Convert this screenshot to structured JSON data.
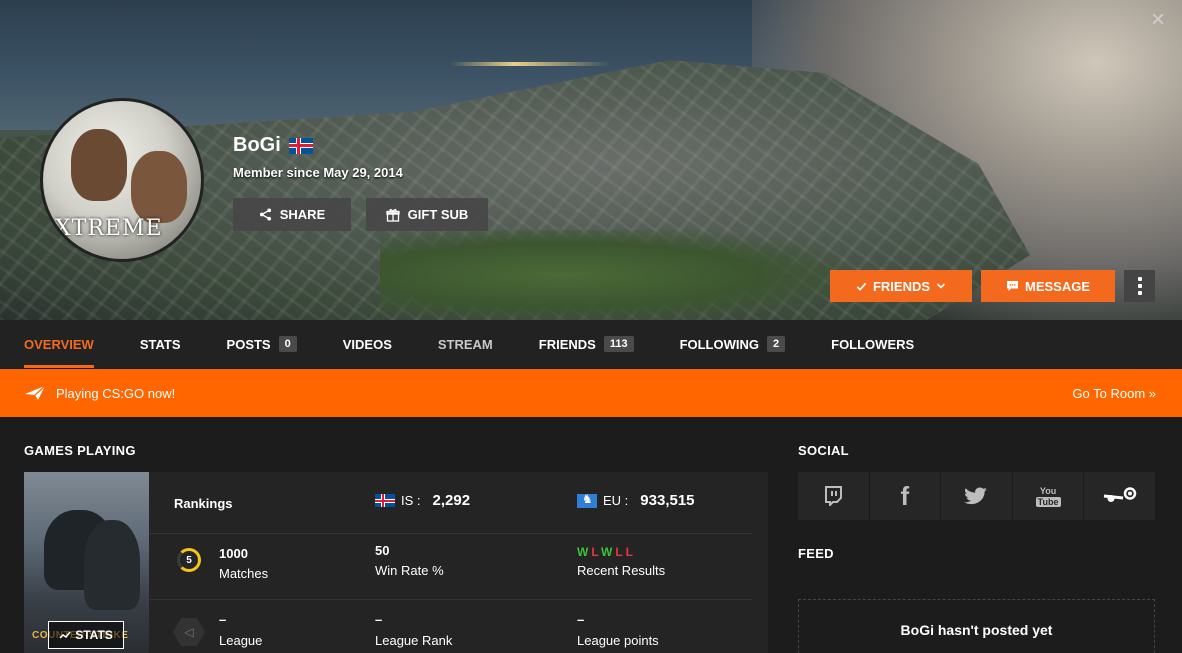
{
  "profile": {
    "username": "BoGi",
    "member_since": "Member since May 29, 2014",
    "avatar_text": "XTREME",
    "share_label": "SHARE",
    "gift_label": "GIFT SUB",
    "friends_label": "FRIENDS",
    "message_label": "MESSAGE",
    "close_glyph": "×"
  },
  "nav": {
    "tabs": [
      {
        "label": "OVERVIEW",
        "count": null,
        "active": true
      },
      {
        "label": "STATS",
        "count": null
      },
      {
        "label": "POSTS",
        "count": "0"
      },
      {
        "label": "VIDEOS",
        "count": null
      },
      {
        "label": "STREAM",
        "count": null
      },
      {
        "label": "FRIENDS",
        "count": "113"
      },
      {
        "label": "FOLLOWING",
        "count": "2"
      },
      {
        "label": "FOLLOWERS",
        "count": null
      }
    ]
  },
  "playing": {
    "status": "Playing CS:GO now!",
    "action": "Go To Room »"
  },
  "games": {
    "title": "GAMES PLAYING",
    "cover_text": "COUNTER-STRIKE",
    "stats_button": "STATS",
    "rankings_label": "Rankings",
    "is_region": "IS :",
    "is_value": "2,292",
    "eu_region": "EU :",
    "eu_value": "933,515",
    "matches_ring": "5",
    "matches_value": "1000",
    "matches_label": "Matches",
    "winrate_value": "50",
    "winrate_label": "Win Rate %",
    "recent_results": [
      "W",
      "L",
      "W",
      "L",
      "L"
    ],
    "recent_label": "Recent Results",
    "league_value": "–",
    "league_label": "League",
    "league_rank_value": "–",
    "league_rank_label": "League Rank",
    "league_points_value": "–",
    "league_points_label": "League points"
  },
  "social": {
    "title": "SOCIAL",
    "items": [
      {
        "name": "twitch",
        "glyph": "⌨"
      },
      {
        "name": "facebook",
        "glyph": "f"
      },
      {
        "name": "twitter",
        "glyph": "🐦"
      },
      {
        "name": "youtube",
        "glyph": "You"
      },
      {
        "name": "steam",
        "glyph": "⚙"
      }
    ]
  },
  "feed": {
    "title": "FEED",
    "empty_text": "BoGi hasn't posted yet"
  },
  "colors": {
    "accent": "#f36a1f",
    "playing_bar": "#ff6600",
    "win": "#3cc43c",
    "loss": "#e03b3b"
  }
}
